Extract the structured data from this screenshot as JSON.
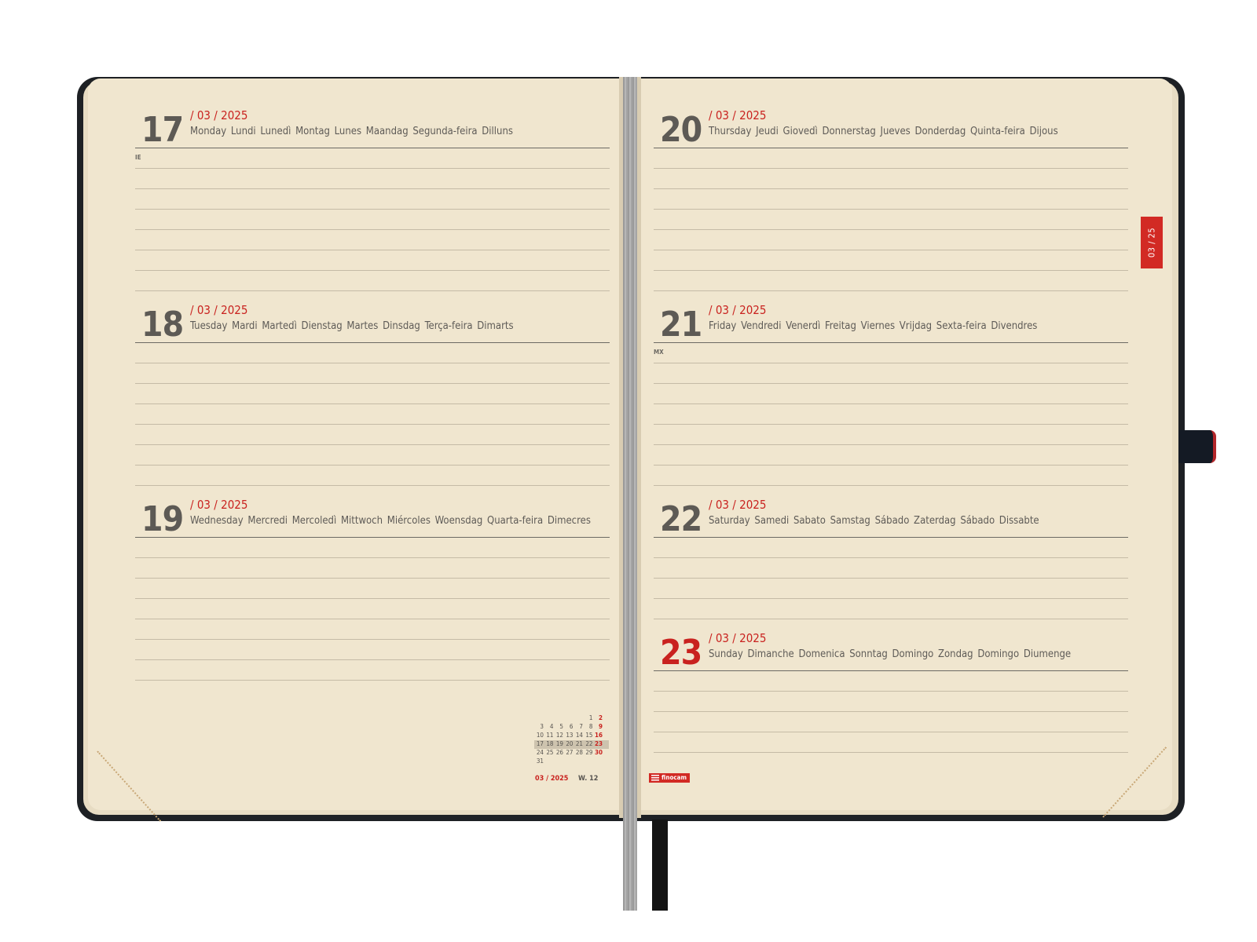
{
  "days_left": [
    {
      "day": "17",
      "date": "/ 03 / 2025",
      "names": "Monday  Lundi  Lunedì  Montag  Lunes  Maandag  Segunda-feira  Dilluns",
      "tag": "IE"
    },
    {
      "day": "18",
      "date": "/ 03 / 2025",
      "names": "Tuesday  Mardi  Martedì  Dienstag  Martes  Dinsdag  Terça-feira  Dimarts",
      "tag": ""
    },
    {
      "day": "19",
      "date": "/ 03 / 2025",
      "names": "Wednesday  Mercredi  Mercoledì  Mittwoch  Miércoles  Woensdag  Quarta-feira  Dimecres",
      "tag": ""
    }
  ],
  "days_right": [
    {
      "day": "20",
      "date": "/ 03 / 2025",
      "names": "Thursday  Jeudi  Giovedì  Donnerstag  Jueves  Donderdag  Quinta-feira  Dijous",
      "tag": ""
    },
    {
      "day": "21",
      "date": "/ 03 / 2025",
      "names": "Friday  Vendredi  Venerdì  Freitag  Viernes  Vrijdag  Sexta-feira  Divendres",
      "tag": "MX"
    },
    {
      "day": "22",
      "date": "/ 03 / 2025",
      "names": "Saturday  Samedi  Sabato  Samstag  Sábado  Zaterdag  Sábado  Dissabte",
      "tag": ""
    },
    {
      "day": "23",
      "date": "/ 03 / 2025",
      "names": "Sunday  Dimanche  Domenica  Sonntag  Domingo  Zondag  Domingo  Diumenge",
      "tag": ""
    }
  ],
  "month_tab": "03 / 25",
  "mini_calendar": {
    "rows": [
      [
        "",
        "",
        "",
        "",
        "",
        "1",
        "2"
      ],
      [
        "3",
        "4",
        "5",
        "6",
        "7",
        "8",
        "9"
      ],
      [
        "10",
        "11",
        "12",
        "13",
        "14",
        "15",
        "16"
      ],
      [
        "17",
        "18",
        "19",
        "20",
        "21",
        "22",
        "23"
      ],
      [
        "24",
        "25",
        "26",
        "27",
        "28",
        "29",
        "30"
      ],
      [
        "31",
        "",
        "",
        "",
        "",
        "",
        ""
      ]
    ],
    "highlight_row": 3
  },
  "footer": {
    "month": "03 / 2025",
    "week": "W. 12"
  },
  "brand": "finocam",
  "colors": {
    "accent": "#c9221f",
    "ink": "#5d5a55",
    "paper": "#f0e6cf",
    "cover": "#1d2024"
  }
}
